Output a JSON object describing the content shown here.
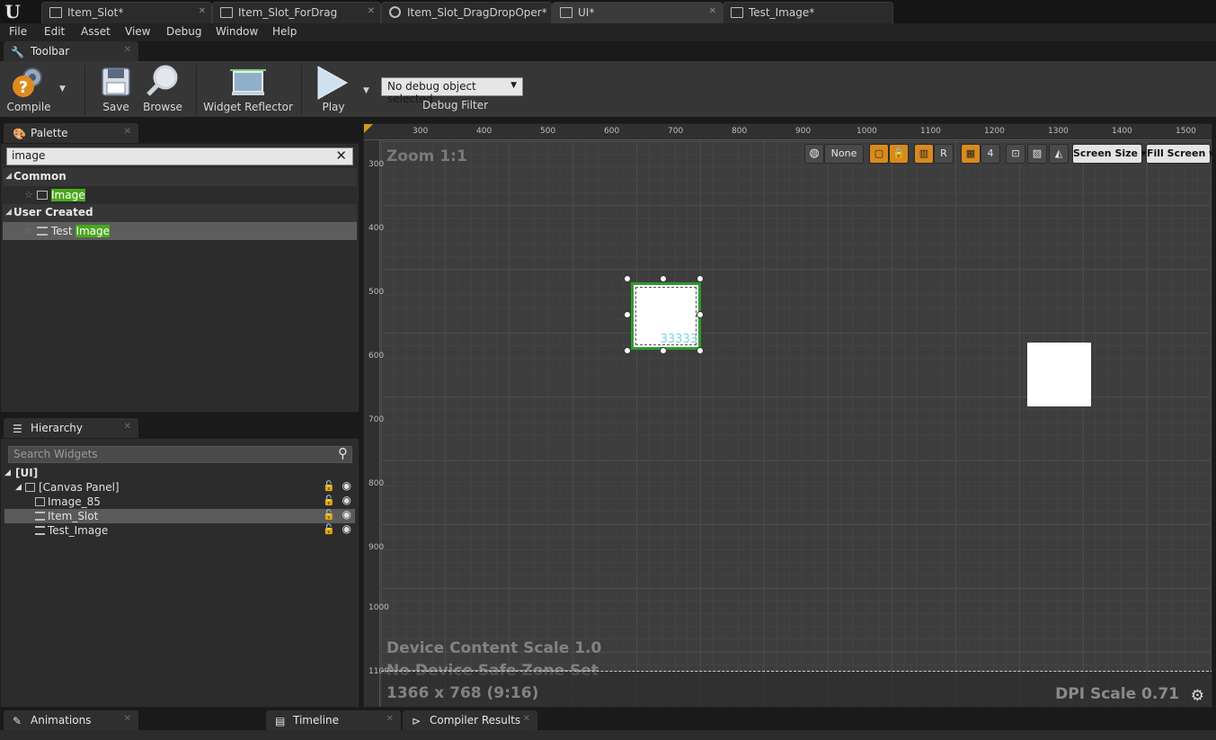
{
  "tabs": [
    {
      "label": "Item_Slot*",
      "icon": "widget-blueprint-icon"
    },
    {
      "label": "Item_Slot_ForDrag",
      "icon": "widget-blueprint-icon"
    },
    {
      "label": "Item_Slot_DragDropOper*",
      "icon": "blueprint-class-icon"
    },
    {
      "label": "UI*",
      "icon": "widget-blueprint-icon"
    },
    {
      "label": "Test_Image*",
      "icon": "widget-blueprint-icon"
    }
  ],
  "menu": [
    "File",
    "Edit",
    "Asset",
    "View",
    "Debug",
    "Window",
    "Help"
  ],
  "toolbar": {
    "panel_title": "Toolbar",
    "compile_label": "Compile",
    "save_label": "Save",
    "browse_label": "Browse",
    "widget_reflector_label": "Widget Reflector",
    "play_label": "Play",
    "debug_object": "No debug object selected",
    "debug_filter_label": "Debug Filter"
  },
  "palette": {
    "title": "Palette",
    "search_value": "image",
    "categories": [
      {
        "name": "Common",
        "items": [
          {
            "prefix": "",
            "match": "Image"
          }
        ]
      },
      {
        "name": "User Created",
        "items": [
          {
            "prefix": "Test ",
            "match": "Image"
          }
        ]
      }
    ]
  },
  "hierarchy": {
    "title": "Hierarchy",
    "search_placeholder": "Search Widgets",
    "root": "[UI]",
    "canvas": "[Canvas Panel]",
    "children": [
      "Image_85",
      "Item_Slot",
      "Test_Image"
    ]
  },
  "designer": {
    "zoom": "Zoom 1:1",
    "ruler_top": [
      "300",
      "400",
      "500",
      "600",
      "700",
      "800",
      "900",
      "1000",
      "1100",
      "1200",
      "1300",
      "1400",
      "1500"
    ],
    "ruler_left": [
      "300",
      "400",
      "500",
      "600",
      "700",
      "800",
      "900",
      "1000",
      "1100"
    ],
    "viewport": {
      "none_label": "None",
      "r_label": "R",
      "grid_snap": "4",
      "screen_size_label": "Screen Size",
      "fill_screen_label": "Fill Screen"
    },
    "selected_widget_text": "33333",
    "device_content_scale": "Device Content Scale 1.0",
    "safe_zone": "No Device Safe Zone Set",
    "resolution": "1366 x 768 (9:16)",
    "dpi_scale": "DPI Scale 0.71"
  },
  "bottom_tabs": [
    "Animations",
    "Timeline",
    "Compiler Results"
  ],
  "colors": {
    "highlight": "#49a81d",
    "selection_border": "#2e9a2e",
    "accent_orange": "#d98a1e",
    "text_cyan": "#7fd2e8"
  }
}
